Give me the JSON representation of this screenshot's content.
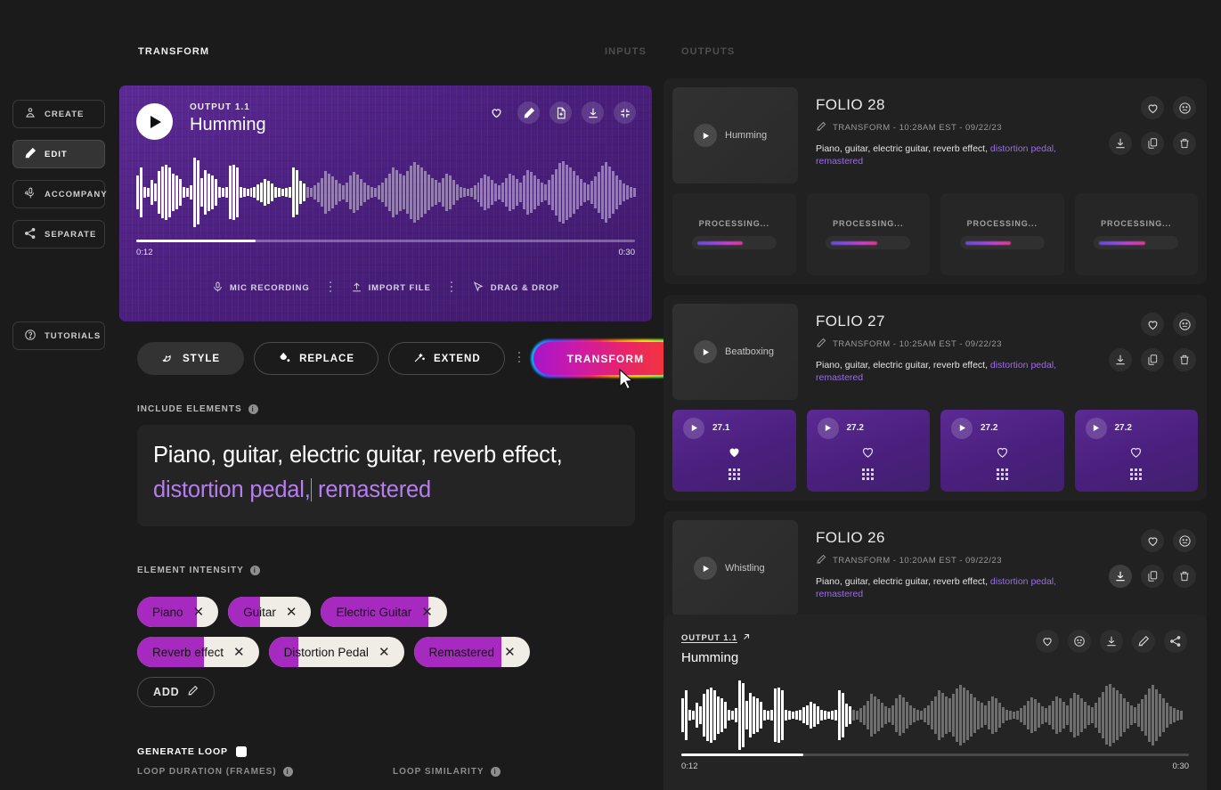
{
  "header": {
    "tabs": [
      {
        "label": "TRANSFORM",
        "active": true
      },
      {
        "label": "INPUTS",
        "active": false
      },
      {
        "label": "OUTPUTS",
        "active": false
      }
    ]
  },
  "sidebar": {
    "items": [
      {
        "label": "CREATE",
        "icon": "create-icon",
        "active": false
      },
      {
        "label": "EDIT",
        "icon": "pen-icon",
        "active": true
      },
      {
        "label": "ACCOMPANY",
        "icon": "mic-hand-icon",
        "active": false
      },
      {
        "label": "SEPARATE",
        "icon": "split-icon",
        "active": false
      }
    ],
    "tutorials": {
      "label": "TUTORIALS",
      "icon": "question-circle-icon"
    }
  },
  "player": {
    "subtitle": "OUTPUT 1.1",
    "title": "Humming",
    "time_current": "0:12",
    "time_total": "0:30",
    "progress_pct": 24,
    "icons": [
      "heart-icon",
      "pen-icon",
      "new-file-icon",
      "download-icon",
      "collapse-icon"
    ],
    "sources": [
      {
        "label": "MIC RECORDING",
        "icon": "mic-icon"
      },
      {
        "label": "IMPORT FILE",
        "icon": "upload-icon"
      },
      {
        "label": "DRAG & DROP",
        "icon": "cursor-arrow-icon"
      }
    ]
  },
  "actions": {
    "style": "STYLE",
    "replace": "REPLACE",
    "extend": "EXTEND",
    "transform": "TRANSFORM"
  },
  "include_elements": {
    "label": "INCLUDE ELEMENTS",
    "text_plain": "Piano, guitar, electric guitar, reverb effect, ",
    "text_highlight_1": "distortion pedal,",
    "text_highlight_2": " remastered"
  },
  "element_intensity": {
    "label": "ELEMENT INTENSITY",
    "add_label": "ADD",
    "chips": [
      {
        "label": "Piano",
        "level": 74
      },
      {
        "label": "Guitar",
        "level": 38
      },
      {
        "label": "Electric Guitar",
        "level": 85
      },
      {
        "label": "Reverb effect",
        "level": 55
      },
      {
        "label": "Distortion Pedal",
        "level": 22
      },
      {
        "label": "Remastered",
        "level": 76
      }
    ]
  },
  "generate_loop": {
    "label": "GENERATE LOOP",
    "checked": true,
    "loop_duration_label": "LOOP DURATION (FRAMES)",
    "loop_similarity_label": "LOOP SIMILARITY"
  },
  "folios": [
    {
      "title": "FOLIO 28",
      "thumb_label": "Humming",
      "meta": "TRANSFORM - 10:28AM EST - 09/22/23",
      "desc_plain": "Piano, guitar, electric guitar, reverb effect, ",
      "desc_highlight": "distortion pedal, remastered",
      "download_active": false,
      "variants": [
        {
          "state": "processing",
          "label": "PROCESSING...",
          "progress": 62
        },
        {
          "state": "processing",
          "label": "PROCESSING...",
          "progress": 62
        },
        {
          "state": "processing",
          "label": "PROCESSING...",
          "progress": 62
        },
        {
          "state": "processing",
          "label": "PROCESSING...",
          "progress": 62
        }
      ]
    },
    {
      "title": "FOLIO 27",
      "thumb_label": "Beatboxing",
      "meta": "TRANSFORM - 10:25AM EST - 09/22/23",
      "desc_plain": "Piano, guitar, electric guitar, reverb effect, ",
      "desc_highlight": "distortion pedal, remastered",
      "download_active": false,
      "variants": [
        {
          "state": "done",
          "label": "27.1",
          "favorite": true
        },
        {
          "state": "done",
          "label": "27.2",
          "favorite": false
        },
        {
          "state": "done",
          "label": "27.2",
          "favorite": false
        },
        {
          "state": "done",
          "label": "27.2",
          "favorite": false
        }
      ]
    },
    {
      "title": "FOLIO 26",
      "thumb_label": "Whistling",
      "meta": "TRANSFORM - 10:20AM EST - 09/22/23",
      "desc_plain": "Piano, guitar, electric guitar, reverb effect, ",
      "desc_highlight": "distortion pedal, remastered",
      "download_active": true,
      "variants": []
    }
  ],
  "dock": {
    "subtitle": "OUTPUT 1.1",
    "title": "Humming",
    "time_current": "0:12",
    "time_total": "0:30",
    "progress_pct": 24,
    "icons": [
      "heart-icon",
      "sad-face-icon",
      "download-icon",
      "pen-icon",
      "share-icon"
    ]
  },
  "waveform": {
    "heights": [
      30,
      44,
      10,
      8,
      22,
      16,
      38,
      46,
      50,
      44,
      34,
      30,
      24,
      10,
      8,
      12,
      62,
      58,
      26,
      40,
      34,
      30,
      24,
      10,
      8,
      10,
      48,
      50,
      44,
      10,
      8,
      6,
      8,
      10,
      14,
      18,
      24,
      20,
      16,
      10,
      8,
      6,
      8,
      10,
      44,
      40,
      20,
      16,
      10,
      8,
      12,
      18,
      26,
      38,
      34,
      28,
      22,
      16,
      12,
      18,
      30,
      36,
      32,
      24,
      18,
      12,
      10,
      8,
      12,
      18,
      26,
      34,
      44,
      40,
      34,
      30,
      38,
      48,
      54,
      50,
      44,
      38,
      32,
      26,
      22,
      18,
      26,
      34,
      30,
      22,
      14,
      10,
      8,
      6,
      8,
      12,
      18,
      26,
      32,
      28,
      22,
      16,
      12,
      18,
      26,
      34,
      30,
      24,
      18,
      30,
      40,
      36,
      30,
      24,
      18,
      14,
      22,
      32,
      42,
      52,
      56,
      50,
      44,
      38,
      30,
      24,
      18,
      14,
      20,
      28,
      36,
      48,
      54,
      46,
      38,
      30,
      22,
      16,
      12,
      10,
      8
    ],
    "hot_count": 48
  }
}
